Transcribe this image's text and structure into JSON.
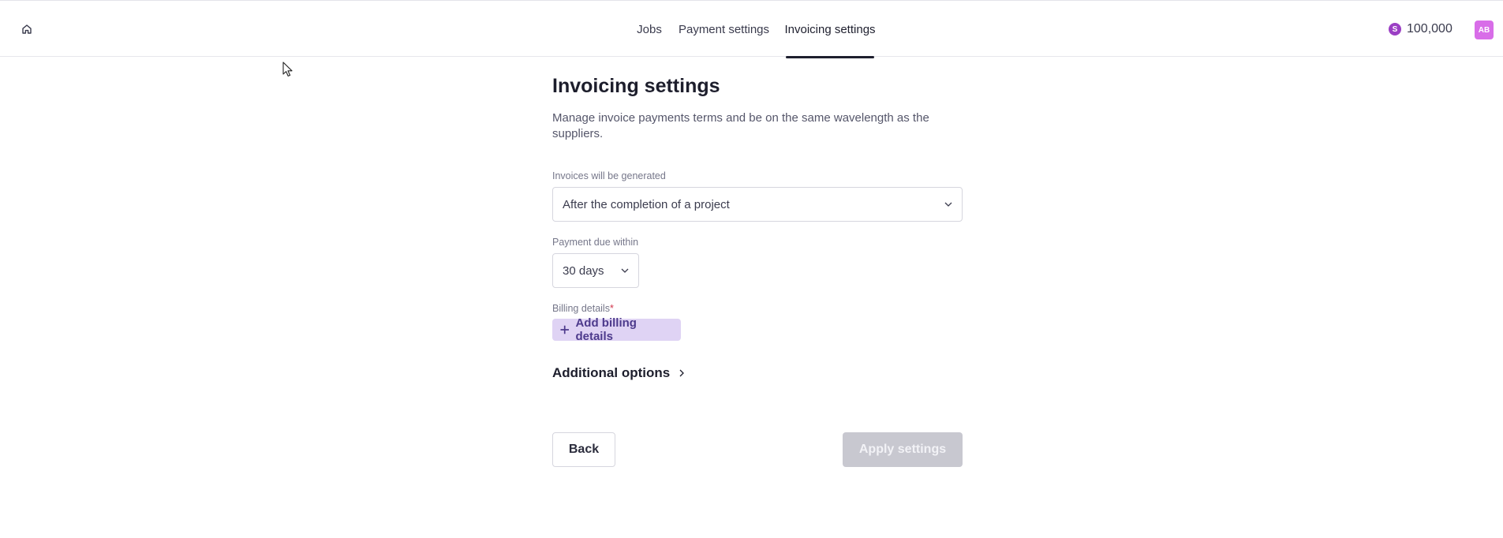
{
  "nav": {
    "home_icon": "home-icon",
    "tabs": [
      {
        "label": "Jobs"
      },
      {
        "label": "Payment settings"
      },
      {
        "label": "Invoicing settings",
        "active": true
      }
    ]
  },
  "account": {
    "coin_symbol": "S",
    "balance": "100,000",
    "avatar_initials": "AB",
    "coin_color": "#9b3fc4",
    "avatar_color": "#d86de8"
  },
  "page": {
    "title": "Invoicing settings",
    "subtitle": "Manage invoice payments terms and be on the same wavelength as the suppliers."
  },
  "form": {
    "invoices_label": "Invoices will be generated",
    "invoices_value": "After the completion of a project",
    "payment_due_label": "Payment due within",
    "payment_due_value": "30 days",
    "billing_label": "Billing details",
    "billing_required_mark": "*",
    "add_billing_label": "Add billing details",
    "additional_options_label": "Additional options"
  },
  "actions": {
    "back_label": "Back",
    "apply_label": "Apply settings"
  },
  "colors": {
    "accent": "#4d3a8c",
    "accent_bg": "#dfd3f4",
    "disabled_button": "#c8c8d0"
  }
}
